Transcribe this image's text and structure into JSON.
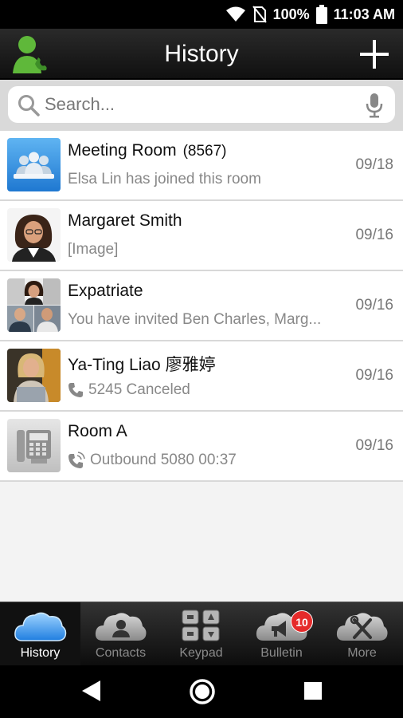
{
  "status_bar": {
    "battery": "100%",
    "time": "11:03 AM"
  },
  "header": {
    "title": "History"
  },
  "search": {
    "placeholder": "Search..."
  },
  "history": [
    {
      "name": "Meeting Room",
      "ext": "(8567)",
      "subtitle": "Elsa Lin has joined this room",
      "date": "09/18",
      "icon": "meeting-room-icon"
    },
    {
      "name": "Margaret Smith",
      "ext": "",
      "subtitle": "[Image]",
      "date": "09/16",
      "icon": "person-avatar"
    },
    {
      "name": "Expatriate",
      "ext": "",
      "subtitle": "You have invited Ben Charles, Marg...",
      "date": "09/16",
      "icon": "group-avatar"
    },
    {
      "name": "Ya-Ting Liao 廖雅婷",
      "ext": "",
      "subtitle": "5245 Canceled",
      "date": "09/16",
      "icon": "phone-icon"
    },
    {
      "name": "Room A",
      "ext": "",
      "subtitle": "Outbound 5080 00:37",
      "date": "09/16",
      "icon": "outbound-call-icon"
    }
  ],
  "tabs": [
    {
      "label": "History",
      "icon": "history-cloud-icon",
      "active": true
    },
    {
      "label": "Contacts",
      "icon": "contacts-cloud-icon"
    },
    {
      "label": "Keypad",
      "icon": "keypad-icon"
    },
    {
      "label": "Bulletin",
      "icon": "bulletin-cloud-icon",
      "badge": "10"
    },
    {
      "label": "More",
      "icon": "tools-cloud-icon"
    }
  ],
  "colors": {
    "accent_blue": "#3b9be6",
    "badge_red": "#e52b2b",
    "header_dark": "#1c1c1c"
  }
}
